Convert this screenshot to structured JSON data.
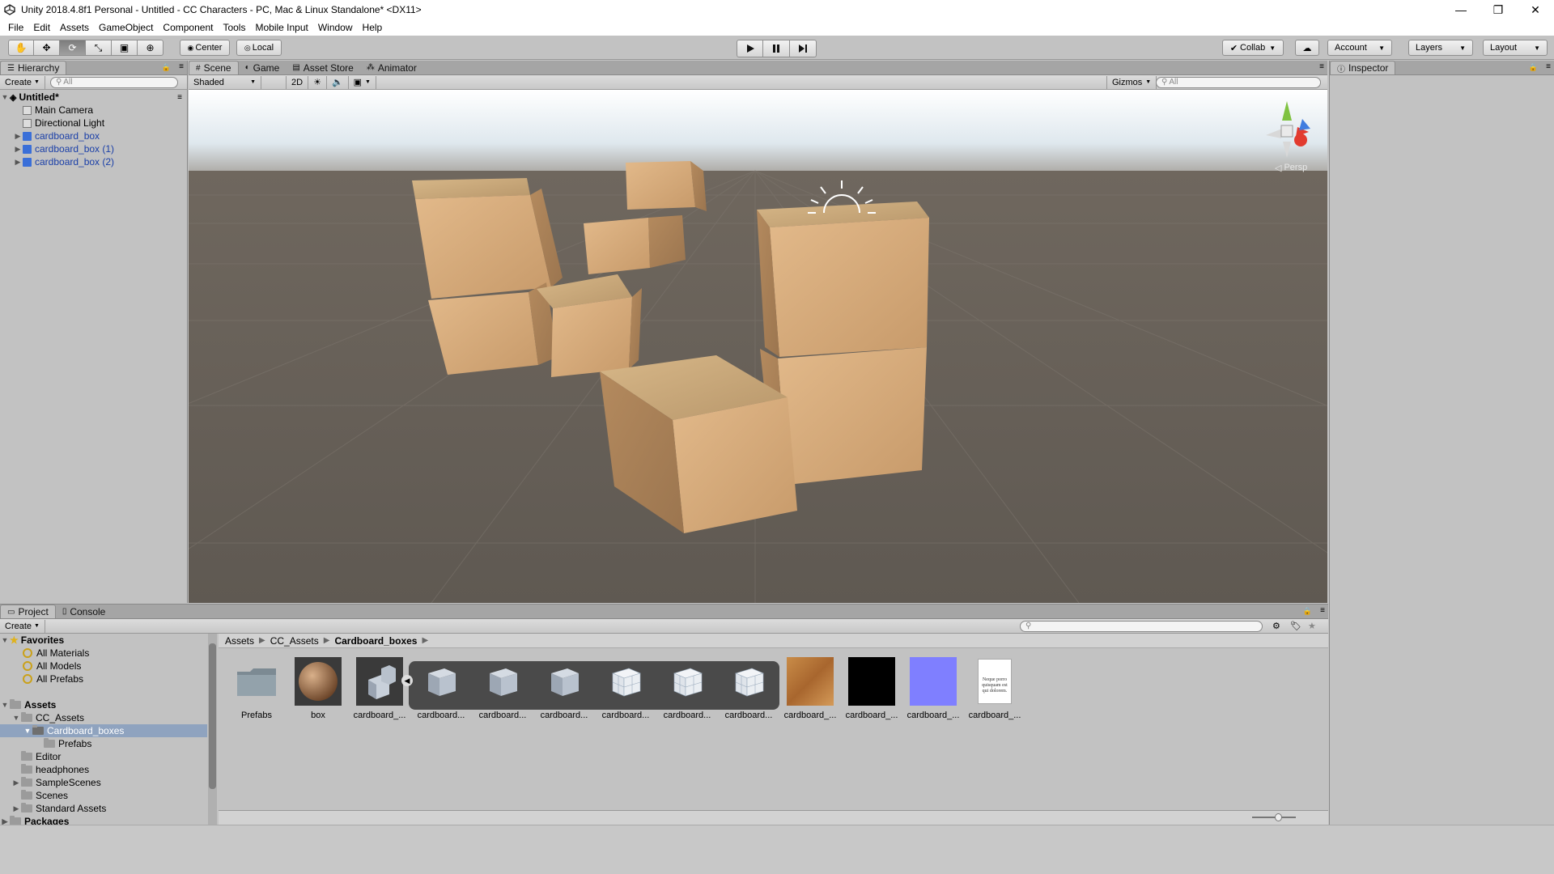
{
  "window": {
    "title": "Unity 2018.4.8f1 Personal - Untitled - CC Characters - PC, Mac & Linux Standalone* <DX11>"
  },
  "menu": [
    "File",
    "Edit",
    "Assets",
    "GameObject",
    "Component",
    "Tools",
    "Mobile Input",
    "Window",
    "Help"
  ],
  "toolbar": {
    "pivot": "Center",
    "space": "Local",
    "collab": "Collab",
    "account": "Account",
    "layers": "Layers",
    "layout": "Layout"
  },
  "hierarchy": {
    "tab": "Hierarchy",
    "create": "Create",
    "search_placeholder": "All",
    "scene": "Untitled*",
    "items": [
      {
        "label": "Main Camera",
        "prefab": false,
        "expandable": false
      },
      {
        "label": "Directional Light",
        "prefab": false,
        "expandable": false
      },
      {
        "label": "cardboard_box",
        "prefab": true,
        "expandable": true
      },
      {
        "label": "cardboard_box (1)",
        "prefab": true,
        "expandable": true
      },
      {
        "label": "cardboard_box (2)",
        "prefab": true,
        "expandable": true
      }
    ]
  },
  "scene_tabs": [
    "Scene",
    "Game",
    "Asset Store",
    "Animator"
  ],
  "scene_toolbar": {
    "shading": "Shaded",
    "mode2d": "2D",
    "gizmos": "Gizmos",
    "search_placeholder": "All",
    "persp": "Persp"
  },
  "inspector": {
    "tab": "Inspector"
  },
  "project": {
    "tabs": [
      "Project",
      "Console"
    ],
    "create": "Create",
    "favorites": {
      "label": "Favorites",
      "items": [
        "All Materials",
        "All Models",
        "All Prefabs"
      ]
    },
    "assets_label": "Assets",
    "tree": [
      {
        "label": "CC_Assets",
        "depth": 1,
        "arrow": "▼"
      },
      {
        "label": "Cardboard_boxes",
        "depth": 2,
        "arrow": "▼",
        "selected": true
      },
      {
        "label": "Prefabs",
        "depth": 3,
        "arrow": ""
      },
      {
        "label": "Editor",
        "depth": 1,
        "arrow": ""
      },
      {
        "label": "headphones",
        "depth": 1,
        "arrow": ""
      },
      {
        "label": "SampleScenes",
        "depth": 1,
        "arrow": "▶"
      },
      {
        "label": "Scenes",
        "depth": 1,
        "arrow": ""
      },
      {
        "label": "Standard Assets",
        "depth": 1,
        "arrow": "▶"
      }
    ],
    "packages_label": "Packages",
    "breadcrumb": [
      "Assets",
      "CC_Assets",
      "Cardboard_boxes"
    ],
    "assets": [
      {
        "label": "Prefabs",
        "kind": "folder"
      },
      {
        "label": "box",
        "kind": "sphere"
      },
      {
        "label": "cardboard_...",
        "kind": "model"
      },
      {
        "label": "cardboard...",
        "kind": "cube"
      },
      {
        "label": "cardboard...",
        "kind": "cube"
      },
      {
        "label": "cardboard...",
        "kind": "cube"
      },
      {
        "label": "cardboard...",
        "kind": "wire"
      },
      {
        "label": "cardboard...",
        "kind": "wire"
      },
      {
        "label": "cardboard...",
        "kind": "wire"
      },
      {
        "label": "cardboard_...",
        "kind": "texture"
      },
      {
        "label": "cardboard_...",
        "kind": "black"
      },
      {
        "label": "cardboard_...",
        "kind": "normal"
      },
      {
        "label": "cardboard_...",
        "kind": "doc"
      }
    ],
    "doc_text": "Neque porro quisquam est qui dolorem."
  }
}
